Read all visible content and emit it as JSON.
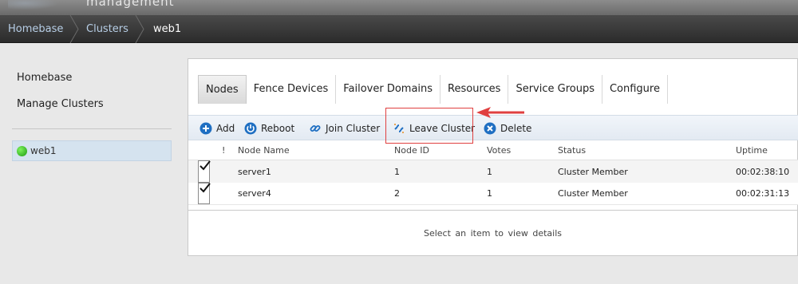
{
  "header": {
    "app_title": "management"
  },
  "breadcrumb": {
    "items": [
      "Homebase",
      "Clusters",
      "web1"
    ]
  },
  "sidebar": {
    "links": [
      "Homebase",
      "Manage Clusters"
    ],
    "cluster": {
      "name": "web1",
      "status_color": "#2ab81e"
    }
  },
  "tabs": [
    "Nodes",
    "Fence Devices",
    "Failover Domains",
    "Resources",
    "Service Groups",
    "Configure"
  ],
  "toolbar": {
    "add": "Add",
    "reboot": "Reboot",
    "join": "Join Cluster",
    "leave": "Leave Cluster",
    "delete": "Delete"
  },
  "table": {
    "headers": {
      "flag": "!",
      "node_name": "Node Name",
      "node_id": "Node ID",
      "votes": "Votes",
      "status": "Status",
      "uptime": "Uptime"
    },
    "rows": [
      {
        "checked": true,
        "node_name": "server1",
        "node_id": "1",
        "votes": "1",
        "status": "Cluster Member",
        "uptime": "00:02:38:10"
      },
      {
        "checked": true,
        "node_name": "server4",
        "node_id": "2",
        "votes": "1",
        "status": "Cluster Member",
        "uptime": "00:02:31:13"
      }
    ]
  },
  "details": {
    "placeholder": "Select an item to view details"
  },
  "colors": {
    "accent": "#1f6fc2",
    "highlight": "#e04040"
  }
}
